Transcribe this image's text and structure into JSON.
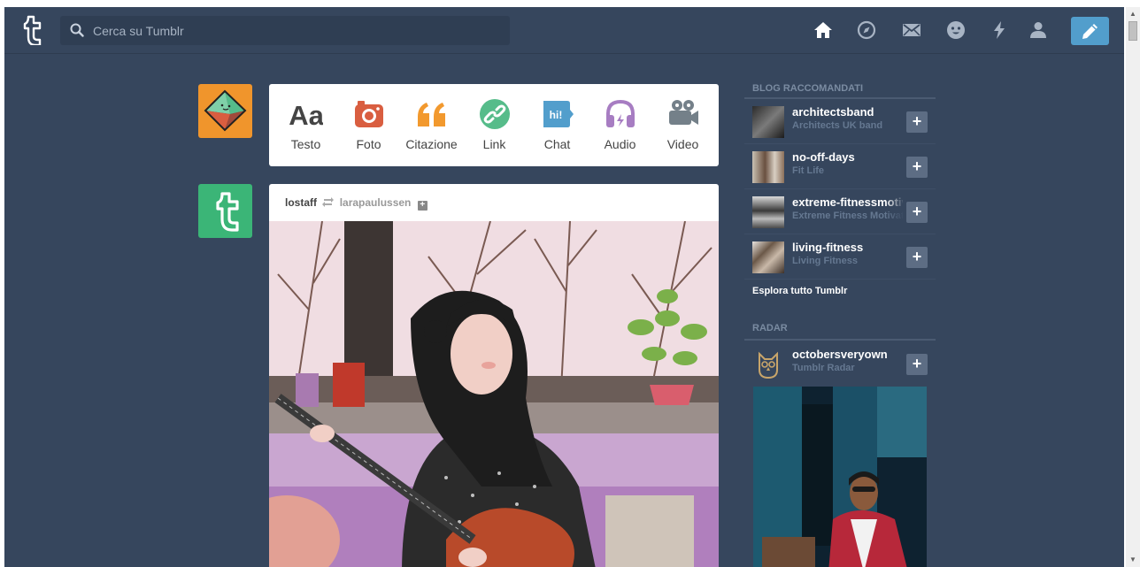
{
  "header": {
    "search_placeholder": "Cerca su Tumblr",
    "icons": [
      "home-icon",
      "explore-icon",
      "messages-icon",
      "ask-icon",
      "activity-icon",
      "account-icon",
      "compose-icon"
    ]
  },
  "post_types": [
    {
      "label": "Testo",
      "icon": "text-icon",
      "glyph": "Aa",
      "color": "#444444"
    },
    {
      "label": "Foto",
      "icon": "camera-icon",
      "color": "#d95e40"
    },
    {
      "label": "Citazione",
      "icon": "quote-icon",
      "glyph": "66",
      "color": "#f2992e"
    },
    {
      "label": "Link",
      "icon": "link-icon",
      "color": "#56bc8a"
    },
    {
      "label": "Chat",
      "icon": "chat-icon",
      "glyph": "hi!",
      "color": "#529ecc"
    },
    {
      "label": "Audio",
      "icon": "headphones-icon",
      "color": "#a77dc2"
    },
    {
      "label": "Video",
      "icon": "video-camera-icon",
      "color": "#748089"
    }
  ],
  "post": {
    "author": "lostaff",
    "reblogged_from": "larapaulussen"
  },
  "sidebar": {
    "recommended_title": "BLOG RACCOMANDATI",
    "blogs": [
      {
        "name": "architectsband",
        "subtitle": "Architects UK band"
      },
      {
        "name": "no-off-days",
        "subtitle": "Fit Life"
      },
      {
        "name": "extreme-fitnessmotivation",
        "subtitle": "Extreme Fitness Motivation"
      },
      {
        "name": "living-fitness",
        "subtitle": "Living Fitness"
      }
    ],
    "follow_label": "+",
    "explore_label": "Esplora tutto Tumblr",
    "radar_title": "RADAR",
    "radar": {
      "name": "octobersveryown",
      "subtitle": "Tumblr Radar"
    }
  },
  "colors": {
    "background": "#36465d",
    "compose": "#529ecc"
  }
}
